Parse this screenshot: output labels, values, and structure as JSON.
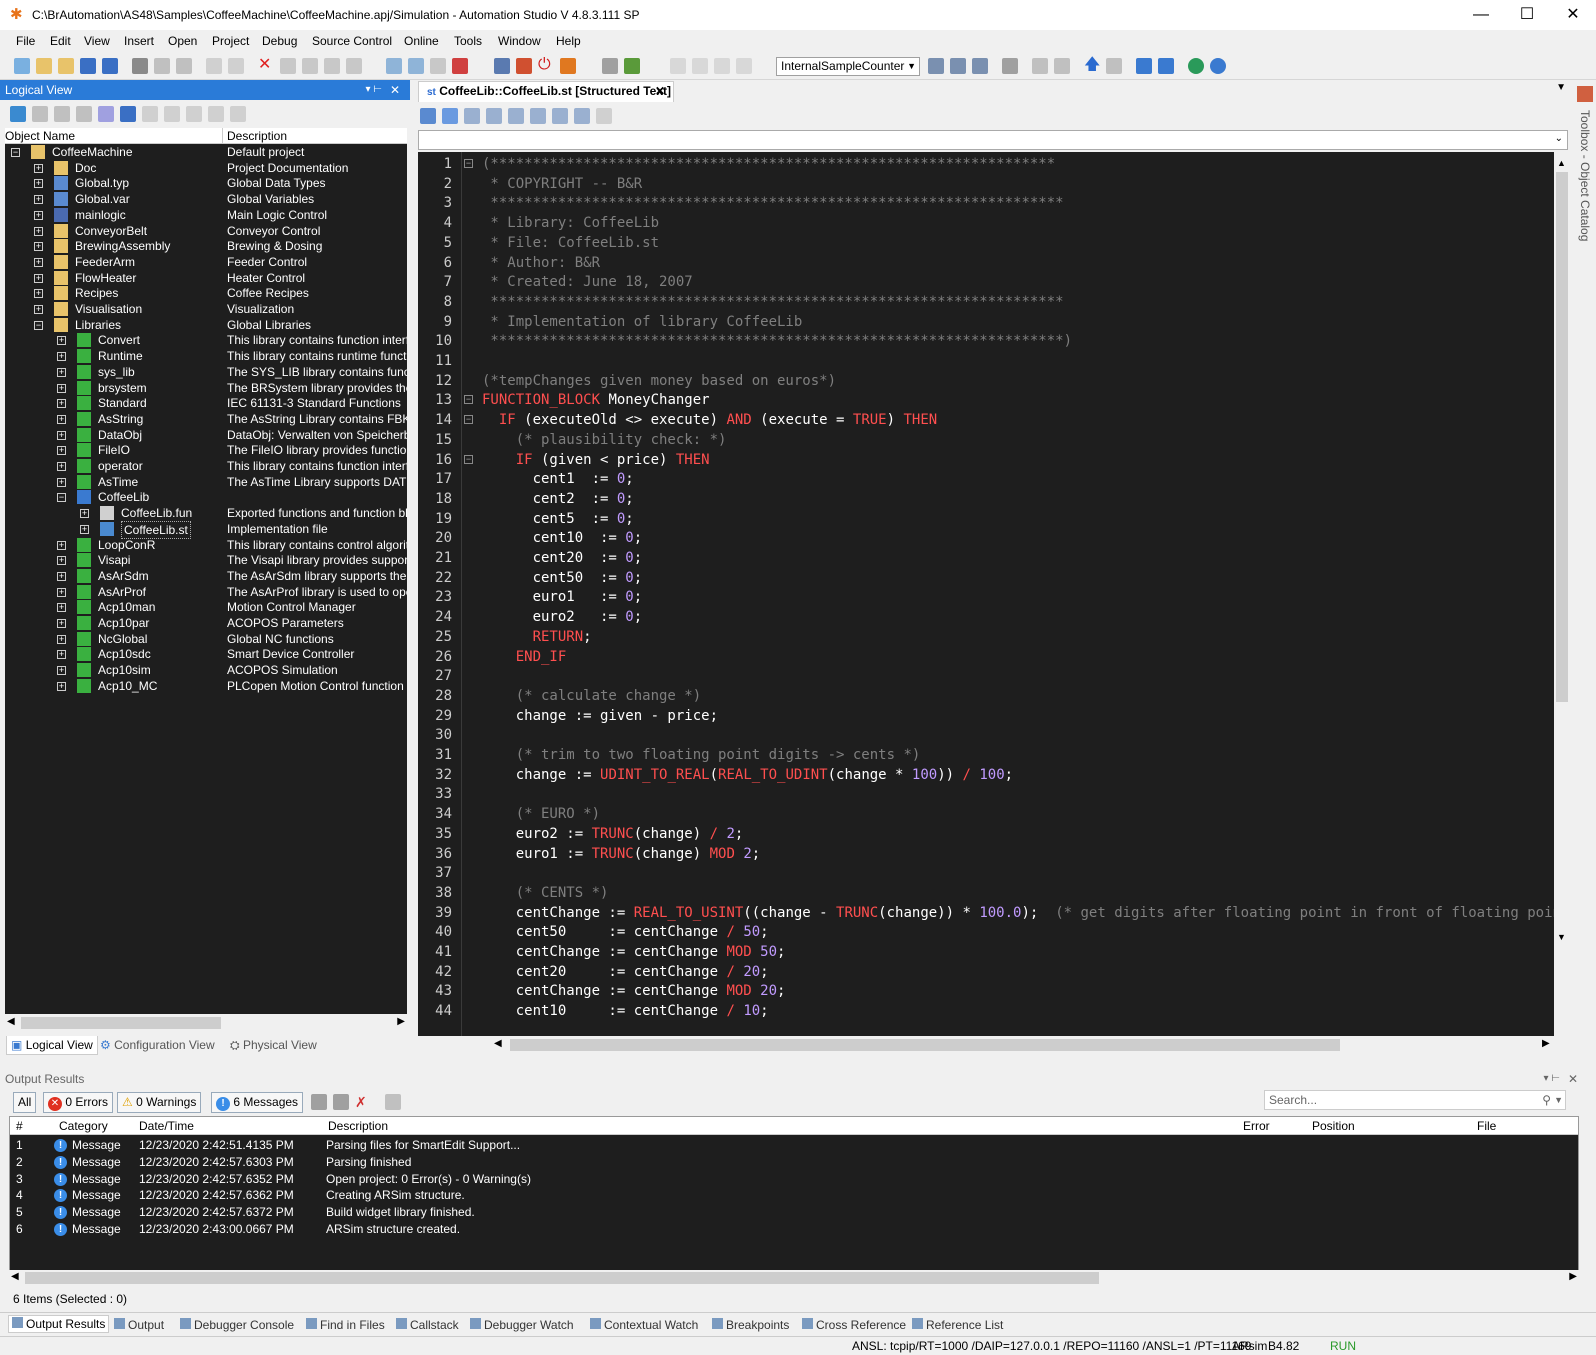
{
  "window": {
    "title": "C:\\BrAutomation\\AS48\\Samples\\CoffeeMachine\\CoffeeMachine.apj/Simulation - Automation Studio V 4.8.3.111 SP",
    "minimize": "—",
    "maximize": "☐",
    "close": "✕"
  },
  "menu": [
    "File",
    "Edit",
    "View",
    "Insert",
    "Open",
    "Project",
    "Debug",
    "Source Control",
    "Online",
    "Tools",
    "Window",
    "Help"
  ],
  "toolbar": {
    "target": "InternalSampleCounter"
  },
  "logical_view": {
    "title": "Logical View",
    "col_name": "Object Name",
    "col_desc": "Description",
    "tree": [
      {
        "name": "CoffeeMachine",
        "desc": "Default project",
        "depth": 0,
        "exp": "−",
        "icon": "folder"
      },
      {
        "name": "Doc",
        "desc": "Project Documentation",
        "depth": 1,
        "exp": "+",
        "icon": "folder"
      },
      {
        "name": "Global.typ",
        "desc": "Global Data Types",
        "depth": 1,
        "exp": "+",
        "icon": "typ"
      },
      {
        "name": "Global.var",
        "desc": "Global Variables",
        "depth": 1,
        "exp": "+",
        "icon": "var"
      },
      {
        "name": "mainlogic",
        "desc": "Main Logic Control",
        "depth": 1,
        "exp": "+",
        "icon": "prog"
      },
      {
        "name": "ConveyorBelt",
        "desc": "Conveyor Control",
        "depth": 1,
        "exp": "+",
        "icon": "folder"
      },
      {
        "name": "BrewingAssembly",
        "desc": "Brewing & Dosing",
        "depth": 1,
        "exp": "+",
        "icon": "folder"
      },
      {
        "name": "FeederArm",
        "desc": "Feeder Control",
        "depth": 1,
        "exp": "+",
        "icon": "folder"
      },
      {
        "name": "FlowHeater",
        "desc": "Heater Control",
        "depth": 1,
        "exp": "+",
        "icon": "folder"
      },
      {
        "name": "Recipes",
        "desc": "Coffee Recipes",
        "depth": 1,
        "exp": "+",
        "icon": "folder"
      },
      {
        "name": "Visualisation",
        "desc": "Visualization",
        "depth": 1,
        "exp": "+",
        "icon": "folder"
      },
      {
        "name": "Libraries",
        "desc": "Global Libraries",
        "depth": 1,
        "exp": "−",
        "icon": "folder"
      },
      {
        "name": "Convert",
        "desc": "This library contains function interfaces",
        "depth": 2,
        "exp": "+",
        "icon": "lib"
      },
      {
        "name": "Runtime",
        "desc": "This library contains runtime functions f",
        "depth": 2,
        "exp": "+",
        "icon": "lib"
      },
      {
        "name": "sys_lib",
        "desc": "The SYS_LIB library contains function",
        "depth": 2,
        "exp": "+",
        "icon": "lib"
      },
      {
        "name": "brsystem",
        "desc": "The BRSystem library provides the use",
        "depth": 2,
        "exp": "+",
        "icon": "lib"
      },
      {
        "name": "Standard",
        "desc": "IEC 61131-3 Standard Functions",
        "depth": 2,
        "exp": "+",
        "icon": "lib"
      },
      {
        "name": "AsString",
        "desc": "The AsString Library contains FBKs for",
        "depth": 2,
        "exp": "+",
        "icon": "lib"
      },
      {
        "name": "DataObj",
        "desc": "DataObj: Verwalten von Speicherbere",
        "depth": 2,
        "exp": "+",
        "icon": "lib"
      },
      {
        "name": "FileIO",
        "desc": "The FileIO library provides function blo",
        "depth": 2,
        "exp": "+",
        "icon": "lib"
      },
      {
        "name": "operator",
        "desc": "This library contains function interfaces",
        "depth": 2,
        "exp": "+",
        "icon": "lib"
      },
      {
        "name": "AsTime",
        "desc": "The AsTime Library supports DATE_A",
        "depth": 2,
        "exp": "+",
        "icon": "lib"
      },
      {
        "name": "CoffeeLib",
        "desc": "",
        "depth": 2,
        "exp": "−",
        "icon": "ulib"
      },
      {
        "name": "CoffeeLib.fun",
        "desc": "Exported functions and function blocks",
        "depth": 3,
        "exp": "+",
        "icon": "fun"
      },
      {
        "name": "CoffeeLib.st",
        "desc": "Implementation file",
        "depth": 3,
        "exp": "+",
        "icon": "st",
        "selected": true
      },
      {
        "name": "LoopConR",
        "desc": "This library contains control algorithms",
        "depth": 2,
        "exp": "+",
        "icon": "lib"
      },
      {
        "name": "Visapi",
        "desc": "The Visapi library provides support to a",
        "depth": 2,
        "exp": "+",
        "icon": "lib"
      },
      {
        "name": "AsArSdm",
        "desc": "The AsArSdm library supports the Syst",
        "depth": 2,
        "exp": "+",
        "icon": "lib"
      },
      {
        "name": "AsArProf",
        "desc": "The AsArProf library is used to operate",
        "depth": 2,
        "exp": "+",
        "icon": "lib"
      },
      {
        "name": "Acp10man",
        "desc": "Motion Control Manager",
        "depth": 2,
        "exp": "+",
        "icon": "lib"
      },
      {
        "name": "Acp10par",
        "desc": "ACOPOS Parameters",
        "depth": 2,
        "exp": "+",
        "icon": "lib"
      },
      {
        "name": "NcGlobal",
        "desc": "Global NC functions",
        "depth": 2,
        "exp": "+",
        "icon": "lib"
      },
      {
        "name": "Acp10sdc",
        "desc": "Smart Device Controller",
        "depth": 2,
        "exp": "+",
        "icon": "lib"
      },
      {
        "name": "Acp10sim",
        "desc": "ACOPOS Simulation",
        "depth": 2,
        "exp": "+",
        "icon": "lib"
      },
      {
        "name": "Acp10_MC",
        "desc": "PLCopen Motion Control function block",
        "depth": 2,
        "exp": "+",
        "icon": "lib"
      }
    ],
    "tabs": [
      "Logical View",
      "Configuration View",
      "Physical View"
    ]
  },
  "editor": {
    "tab": "CoffeeLib::CoffeeLib.st [Structured Text]",
    "lines": [
      [
        [
          "cm",
          "(*******************************************************************"
        ]
      ],
      [
        [
          "cm",
          " * COPYRIGHT -- B&R"
        ]
      ],
      [
        [
          "cm",
          " ********************************************************************"
        ]
      ],
      [
        [
          "cm",
          " * Library: CoffeeLib"
        ]
      ],
      [
        [
          "cm",
          " * File: CoffeeLib.st"
        ]
      ],
      [
        [
          "cm",
          " * Author: B&R"
        ]
      ],
      [
        [
          "cm",
          " * Created: June 18, 2007"
        ]
      ],
      [
        [
          "cm",
          " ********************************************************************"
        ]
      ],
      [
        [
          "cm",
          " * Implementation of library CoffeeLib"
        ]
      ],
      [
        [
          "cm",
          " ********************************************************************)"
        ]
      ],
      [],
      [
        [
          "cm",
          "(*tempChanges given money based on euros*)"
        ]
      ],
      [
        [
          "kw",
          "FUNCTION_BLOCK"
        ],
        [
          "tx",
          " MoneyChanger"
        ]
      ],
      [
        [
          "tx",
          "  "
        ],
        [
          "kw",
          "IF"
        ],
        [
          "tx",
          " (executeOld <> execute) "
        ],
        [
          "kw",
          "AND"
        ],
        [
          "tx",
          " (execute = "
        ],
        [
          "kw",
          "TRUE"
        ],
        [
          "tx",
          ") "
        ],
        [
          "kw",
          "THEN"
        ]
      ],
      [
        [
          "tx",
          "    "
        ],
        [
          "cm",
          "(* plausibility check: *)"
        ]
      ],
      [
        [
          "tx",
          "    "
        ],
        [
          "kw",
          "IF"
        ],
        [
          "tx",
          " (given < price) "
        ],
        [
          "kw",
          "THEN"
        ]
      ],
      [
        [
          "tx",
          "      cent1  := "
        ],
        [
          "nu",
          "0"
        ],
        [
          "tx",
          ";"
        ]
      ],
      [
        [
          "tx",
          "      cent2  := "
        ],
        [
          "nu",
          "0"
        ],
        [
          "tx",
          ";"
        ]
      ],
      [
        [
          "tx",
          "      cent5  := "
        ],
        [
          "nu",
          "0"
        ],
        [
          "tx",
          ";"
        ]
      ],
      [
        [
          "tx",
          "      cent10  := "
        ],
        [
          "nu",
          "0"
        ],
        [
          "tx",
          ";"
        ]
      ],
      [
        [
          "tx",
          "      cent20  := "
        ],
        [
          "nu",
          "0"
        ],
        [
          "tx",
          ";"
        ]
      ],
      [
        [
          "tx",
          "      cent50  := "
        ],
        [
          "nu",
          "0"
        ],
        [
          "tx",
          ";"
        ]
      ],
      [
        [
          "tx",
          "      euro1   := "
        ],
        [
          "nu",
          "0"
        ],
        [
          "tx",
          ";"
        ]
      ],
      [
        [
          "tx",
          "      euro2   := "
        ],
        [
          "nu",
          "0"
        ],
        [
          "tx",
          ";"
        ]
      ],
      [
        [
          "tx",
          "      "
        ],
        [
          "kw",
          "RETURN"
        ],
        [
          "tx",
          ";"
        ]
      ],
      [
        [
          "tx",
          "    "
        ],
        [
          "kw",
          "END_IF"
        ]
      ],
      [],
      [
        [
          "tx",
          "    "
        ],
        [
          "cm",
          "(* calculate change *)"
        ]
      ],
      [
        [
          "tx",
          "    change := given - price;"
        ]
      ],
      [],
      [
        [
          "tx",
          "    "
        ],
        [
          "cm",
          "(* trim to two floating point digits -> cents *)"
        ]
      ],
      [
        [
          "tx",
          "    change := "
        ],
        [
          "kw",
          "UDINT_TO_REAL"
        ],
        [
          "tx",
          "("
        ],
        [
          "kw",
          "REAL_TO_UDINT"
        ],
        [
          "tx",
          "(change * "
        ],
        [
          "nu",
          "100"
        ],
        [
          "tx",
          ")) "
        ],
        [
          "kw",
          "/"
        ],
        [
          "tx",
          " "
        ],
        [
          "nu",
          "100"
        ],
        [
          "tx",
          ";"
        ]
      ],
      [],
      [
        [
          "tx",
          "    "
        ],
        [
          "cm",
          "(* EURO *)"
        ]
      ],
      [
        [
          "tx",
          "    euro2 := "
        ],
        [
          "kw",
          "TRUNC"
        ],
        [
          "tx",
          "(change) "
        ],
        [
          "kw",
          "/"
        ],
        [
          "tx",
          " "
        ],
        [
          "nu",
          "2"
        ],
        [
          "tx",
          ";"
        ]
      ],
      [
        [
          "tx",
          "    euro1 := "
        ],
        [
          "kw",
          "TRUNC"
        ],
        [
          "tx",
          "(change) "
        ],
        [
          "kw",
          "MOD"
        ],
        [
          "tx",
          " "
        ],
        [
          "nu",
          "2"
        ],
        [
          "tx",
          ";"
        ]
      ],
      [],
      [
        [
          "tx",
          "    "
        ],
        [
          "cm",
          "(* CENTS *)"
        ]
      ],
      [
        [
          "tx",
          "    centChange := "
        ],
        [
          "kw",
          "REAL_TO_USINT"
        ],
        [
          "tx",
          "((change - "
        ],
        [
          "kw",
          "TRUNC"
        ],
        [
          "tx",
          "(change)) * "
        ],
        [
          "nu",
          "100.0"
        ],
        [
          "tx",
          ");  "
        ],
        [
          "cm",
          "(* get digits after floating point in front of floating point (int"
        ]
      ],
      [
        [
          "tx",
          "    cent50     := centChange "
        ],
        [
          "kw",
          "/"
        ],
        [
          "tx",
          " "
        ],
        [
          "nu",
          "50"
        ],
        [
          "tx",
          ";"
        ]
      ],
      [
        [
          "tx",
          "    centChange := centChange "
        ],
        [
          "kw",
          "MOD"
        ],
        [
          "tx",
          " "
        ],
        [
          "nu",
          "50"
        ],
        [
          "tx",
          ";"
        ]
      ],
      [
        [
          "tx",
          "    cent20     := centChange "
        ],
        [
          "kw",
          "/"
        ],
        [
          "tx",
          " "
        ],
        [
          "nu",
          "20"
        ],
        [
          "tx",
          ";"
        ]
      ],
      [
        [
          "tx",
          "    centChange := centChange "
        ],
        [
          "kw",
          "MOD"
        ],
        [
          "tx",
          " "
        ],
        [
          "nu",
          "20"
        ],
        [
          "tx",
          ";"
        ]
      ],
      [
        [
          "tx",
          "    cent10     := centChange "
        ],
        [
          "kw",
          "/"
        ],
        [
          "tx",
          " "
        ],
        [
          "nu",
          "10"
        ],
        [
          "tx",
          ";"
        ]
      ]
    ]
  },
  "output": {
    "title": "Output Results",
    "filters": {
      "all": "All",
      "errors": "0 Errors",
      "warnings": "0 Warnings",
      "messages": "6 Messages"
    },
    "search_placeholder": "Search...",
    "columns": [
      "#",
      "Category",
      "Date/Time",
      "Description",
      "Error",
      "Position",
      "File"
    ],
    "rows": [
      [
        "1",
        "Message",
        "12/23/2020 2:42:51.4135 PM",
        "Parsing files for SmartEdit Support..."
      ],
      [
        "2",
        "Message",
        "12/23/2020 2:42:57.6303 PM",
        "Parsing finished"
      ],
      [
        "3",
        "Message",
        "12/23/2020 2:42:57.6352 PM",
        "Open project: 0 Error(s) - 0 Warning(s)"
      ],
      [
        "4",
        "Message",
        "12/23/2020 2:42:57.6362 PM",
        "Creating ARSim structure."
      ],
      [
        "5",
        "Message",
        "12/23/2020 2:42:57.6372 PM",
        "Build widget library finished."
      ],
      [
        "6",
        "Message",
        "12/23/2020 2:43:00.0667 PM",
        "ARSim structure created."
      ]
    ],
    "count": "6 Items (Selected : 0)"
  },
  "bottom_tabs": [
    "Output Results",
    "Output",
    "Debugger Console",
    "Find in Files",
    "Callstack",
    "Debugger Watch",
    "Contextual Watch",
    "Breakpoints",
    "Cross Reference",
    "Reference List"
  ],
  "status": {
    "conn": "ANSL: tcpip/RT=1000 /DAIP=127.0.0.1 /REPO=11160 /ANSL=1 /PT=11169",
    "sim": "ARsim",
    "ver": "B4.82",
    "state": "RUN"
  },
  "toolbox": "Toolbox - Object Catalog",
  "colors": {
    "accent": "#2a7bd8",
    "editor_bg": "#1e1e1e",
    "keyword": "#ff4f4f",
    "number": "#c19bff",
    "comment": "#7f7f7f"
  }
}
